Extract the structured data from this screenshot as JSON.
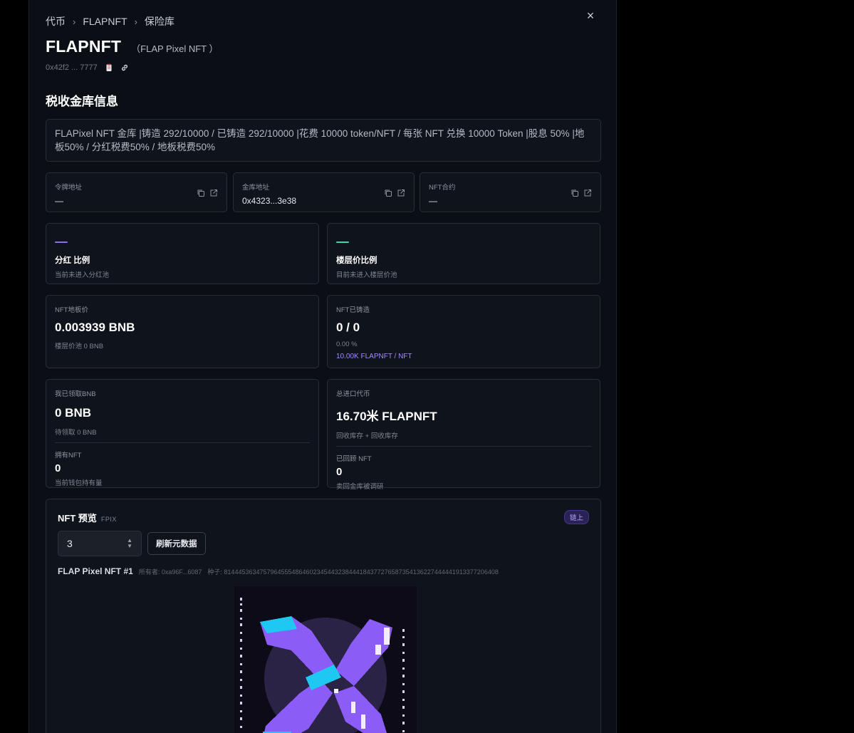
{
  "breadcrumb": {
    "items": [
      "代币",
      "FLAPNFT",
      "保险库"
    ],
    "separator": "›"
  },
  "close_label": "×",
  "header": {
    "title": "FLAPNFT",
    "subtitle": "（FLAP Pixel NFT ）",
    "contract_short": "0x42f2 ... 7777"
  },
  "section_title": "税收金库信息",
  "description": "FLAPixel NFT 金库 |铸造 292/10000 / 已铸造 292/10000 |花费 10000 token/NFT / 每张 NFT 兑换 10000 Token |股息 50% |地板50% / 分红税费50% / 地板税费50%",
  "addresses": [
    {
      "label": "令牌地址",
      "value": "—"
    },
    {
      "label": "金库地址",
      "value": "0x4323...3e38"
    },
    {
      "label": "NFT合约",
      "value": "—"
    }
  ],
  "ratios": [
    {
      "name": "分红 比例",
      "sub": "当前未进入分红池",
      "color": "#8b6cf0"
    },
    {
      "name": "楼层价比例",
      "sub": "目前未进入楼层价池",
      "color": "#3ed6a4"
    }
  ],
  "floor": {
    "label": "NFT地板价",
    "value": "0.003939 BNB",
    "sub": "楼层价池 0 BNB"
  },
  "minted": {
    "label": "NFT已铸造",
    "value": "0 / 0",
    "percent": "0.00 %",
    "rate": "10.00K FLAPNFT / NFT"
  },
  "claim": {
    "label": "我已领取BNB",
    "value": "0 BNB",
    "sub": "待领取 0 BNB",
    "owned_label": "拥有NFT",
    "owned_value": "0",
    "owned_sub": "当前钱包持有量"
  },
  "imported": {
    "label": "总进口代币",
    "value": "16.70米 FLAPNFT",
    "sub": "回收库存 + 回收库存",
    "bought_label": "已回顾 NFT",
    "bought_value": "0",
    "bought_sub": "卖回金库被调研"
  },
  "preview": {
    "title": "NFT 预览",
    "tag": "FPIX",
    "badge": "链上",
    "token_id": "3",
    "refresh_label": "刷新元数据",
    "nft_name": "FLAP Pixel NFT #1",
    "owner_label": "所有者:",
    "owner": "0xa96F...6087",
    "seed_label": "种子:",
    "seed": "81444536347579645554864602345443238444184377276587354136227444441913377206408"
  },
  "colors": {
    "accent_purple": "#8b6cf0",
    "accent_cyan": "#1ec8f0",
    "accent_green": "#3ed6a4"
  }
}
